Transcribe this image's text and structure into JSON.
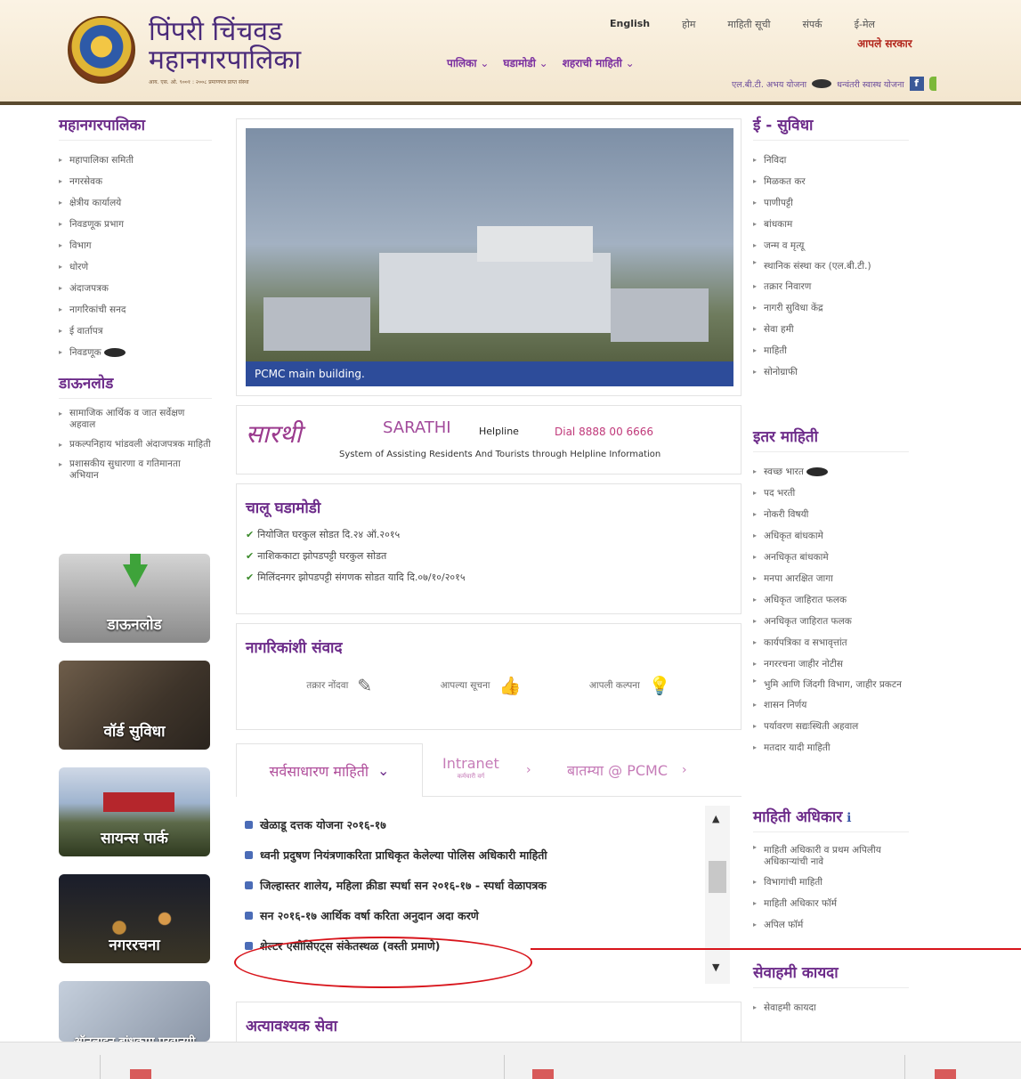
{
  "header": {
    "logo_title_line1": "पिंपरी चिंचवड",
    "logo_title_line2": "महानगरपालिका",
    "logo_sub": "आय. एस. ओ. ९००१ : २००८ प्रमाणपत्र प्राप्त संस्था",
    "top_links": [
      "English",
      "होम",
      "माहिती सूची",
      "संपर्क",
      "ई-मेल"
    ],
    "main_nav": [
      "पालिका",
      "घडामोडी",
      "शहराची माहिती"
    ],
    "aaple_sarkar": "आपले सरकार",
    "yojana_1": "एल.बी.टी. अभय योजना",
    "yojana_2": "धन्वंतरी स्वास्थ योजना",
    "fb": "f"
  },
  "left": {
    "section1_title": "महानगरपालिका",
    "section1_items": [
      "महापालिका समिती",
      "नगरसेवक",
      "क्षेत्रीय कार्यालये",
      "निवडणूक प्रभाग",
      "विभाग",
      "धोरणे",
      "अंदाजपत्रक",
      "नागरिकांची सनद",
      "ई वार्तापत्र",
      "निवडणूक"
    ],
    "section2_title": "डाऊनलोड",
    "section2_items": [
      "सामाजिक आर्थिक व जात सर्वेक्षण अहवाल",
      "प्रकल्पनिहाय भांडवली अंदाजपत्रक माहिती",
      "प्रशासकीय सुधारणा व गतिमानता अभियान"
    ],
    "tiles": [
      "डाऊनलोड",
      "वॉर्ड सुविधा",
      "सायन्स पार्क",
      "नगररचना",
      "ऑनलाइन बांधकाम परवानगी"
    ]
  },
  "center": {
    "slider_caption": "PCMC main building.",
    "sarathi_mark": "सारथी",
    "sarathi_title": "SARATHI",
    "sarathi_helpline": "Helpline",
    "sarathi_dial": "Dial 8888 00 6666",
    "sarathi_expansion": "System of Assisting Residents And Tourists through Helpline Information",
    "current_title": "चालू घडामोडी",
    "current_items": [
      "नियोजित घरकुल सोडत दि.२४ ऑ.२०१५",
      "नाशिककाटा झोपडपट्टी घरकुल सोडत",
      "मिलिंदनगर झोपडपट्टी संगणक सोडत यादि दि.०७/१०/२०१५"
    ],
    "samvad_title": "नागरिकांशी संवाद",
    "samvad_items": [
      "तक्रार नोंदवा",
      "आपल्या सूचना",
      "आपली कल्पना"
    ],
    "tab1": "सर्वसाधारण माहिती",
    "tab2": "Intranet",
    "tab2_sub": "कर्मचारी वर्ग",
    "tab3": "बातम्या @ PCMC",
    "news": [
      "खेळाडू दत्तक योजना २०१६-१७",
      "ध्वनी प्रदुषण नियंत्रणाकरिता प्राधिकृत केलेल्या पोलिस अधिकारी माहिती",
      "जिल्हास्तर शालेय, महिला क्रीडा स्पर्धा सन २०१६-१७ - स्पर्धा वेळापत्रक",
      "सन २०१६-१७ आर्थिक वर्षा करिता अनुदान अदा करणे",
      "शेल्टर एसोसिएट्स संकेतस्थळ (वस्ती प्रमाणे)"
    ],
    "urgent_title": "अत्यावश्यक सेवा"
  },
  "right": {
    "esuvidha_title": "ई - सुविधा",
    "esuvidha_items": [
      "निविदा",
      "मिळकत कर",
      "पाणीपट्टी",
      "बांधकाम",
      "जन्म व मृत्यू",
      "स्थानिक संस्था कर (एल.बी.टी.)",
      "तक्रार निवारण",
      "नागरी सुविधा केंद्र",
      "सेवा हमी",
      "माहिती",
      "सोनोग्राफी"
    ],
    "itar_title": "इतर माहिती",
    "itar_items": [
      "स्वच्छ भारत",
      "पद भरती",
      "नोकरी विषयी",
      "अधिकृत बांधकामे",
      "अनधिकृत बांधकामे",
      "मनपा आरक्षित जागा",
      "अधिकृत जाहिरात फलक",
      "अनधिकृत जाहिरात फलक",
      "कार्यपत्रिका व सभावृत्तांत",
      "नगररचना जाहीर नोटीस",
      "भुमि आणि जिंदगी विभाग, जाहीर प्रकटन",
      "शासन निर्णय",
      "पर्यावरण सद्यःस्थिती अहवाल",
      "मतदार यादी माहिती"
    ],
    "rti_title": "माहिती अधिकार",
    "rti_items": [
      "माहिती अधिकारी व प्रथम अपिलीय अधिकाऱ्यांची नावे",
      "विभागांची माहिती",
      "माहिती अधिकार फॉर्म",
      "अपिल फॉर्म"
    ],
    "sevahami_title": "सेवाहमी कायदा",
    "sevahami_items": [
      "सेवाहमी कायदा"
    ]
  }
}
